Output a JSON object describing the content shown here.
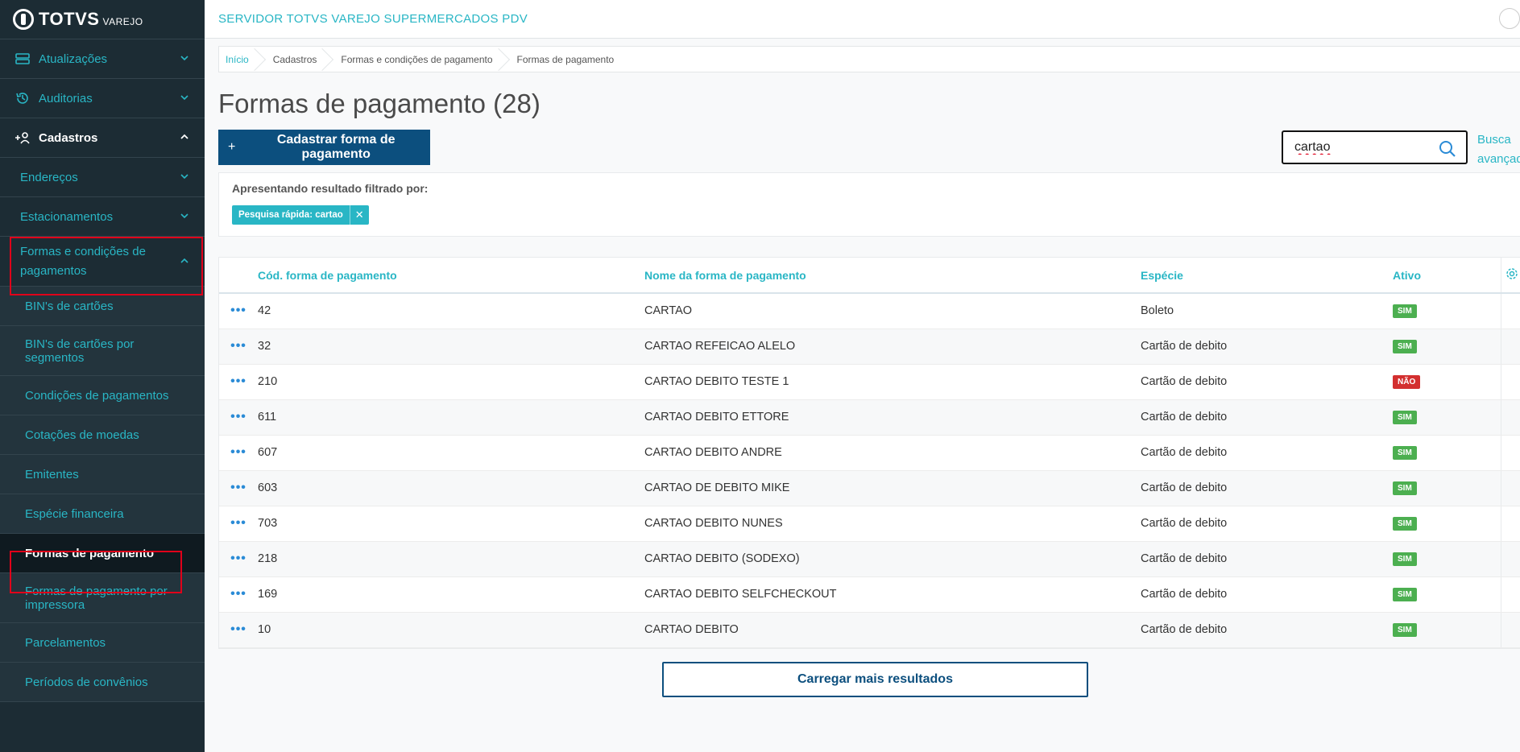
{
  "brand": {
    "name": "TOTVS",
    "sub": "VAREJO"
  },
  "sidebar": {
    "items": [
      {
        "label": "Atualizações",
        "icon": "server-icon"
      },
      {
        "label": "Auditorias",
        "icon": "history-icon"
      },
      {
        "label": "Cadastros",
        "icon": "add-user-icon"
      },
      {
        "label": "Endereços"
      },
      {
        "label": "Estacionamentos"
      },
      {
        "label": "Formas e condições de pagamentos"
      },
      {
        "label": "BIN's de cartões"
      },
      {
        "label": "BIN's de cartões por segmentos"
      },
      {
        "label": "Condições de pagamentos"
      },
      {
        "label": "Cotações de moedas"
      },
      {
        "label": "Emitentes"
      },
      {
        "label": "Espécie financeira"
      },
      {
        "label": "Formas de pagamento"
      },
      {
        "label": "Formas de pagamento por impressora"
      },
      {
        "label": "Parcelamentos"
      },
      {
        "label": "Períodos de convênios"
      }
    ]
  },
  "header": {
    "server_title": "SERVIDOR TOTVS VAREJO SUPERMERCADOS PDV"
  },
  "breadcrumb": [
    "Início",
    "Cadastros",
    "Formas e condições de pagamento",
    "Formas de pagamento"
  ],
  "page": {
    "title": "Formas de pagamento (28)",
    "add_button": "Cadastrar forma de pagamento",
    "search_value": "cartao",
    "advanced_search": "Busca avançada"
  },
  "filter": {
    "label": "Apresentando resultado filtrado por:",
    "chip": "Pesquisa rápida: cartao"
  },
  "table": {
    "headers": [
      "Cód. forma de pagamento",
      "Nome da forma de pagamento",
      "Espécie",
      "Ativo"
    ],
    "rows": [
      {
        "code": "42",
        "name": "CARTAO",
        "especie": "Boleto",
        "ativo": "SIM"
      },
      {
        "code": "32",
        "name": "CARTAO REFEICAO ALELO",
        "especie": "Cartão de debito",
        "ativo": "SIM"
      },
      {
        "code": "210",
        "name": "CARTAO DEBITO TESTE 1",
        "especie": "Cartão de debito",
        "ativo": "NÃO"
      },
      {
        "code": "611",
        "name": "CARTAO DEBITO ETTORE",
        "especie": "Cartão de debito",
        "ativo": "SIM"
      },
      {
        "code": "607",
        "name": "CARTAO DEBITO ANDRE",
        "especie": "Cartão de debito",
        "ativo": "SIM"
      },
      {
        "code": "603",
        "name": "CARTAO DE DEBITO MIKE",
        "especie": "Cartão de debito",
        "ativo": "SIM"
      },
      {
        "code": "703",
        "name": "CARTAO DEBITO NUNES",
        "especie": "Cartão de debito",
        "ativo": "SIM"
      },
      {
        "code": "218",
        "name": "CARTAO DEBITO (SODEXO)",
        "especie": "Cartão de debito",
        "ativo": "SIM"
      },
      {
        "code": "169",
        "name": "CARTAO DEBITO SELFCHECKOUT",
        "especie": "Cartão de debito",
        "ativo": "SIM"
      },
      {
        "code": "10",
        "name": "CARTAO DEBITO",
        "especie": "Cartão de debito",
        "ativo": "SIM"
      }
    ]
  },
  "load_more": "Carregar mais resultados",
  "colors": {
    "accent": "#29b6c5",
    "primary": "#0c4f7e",
    "sidebar": "#1c2c34",
    "success": "#4caf50",
    "danger": "#d32f2f"
  }
}
